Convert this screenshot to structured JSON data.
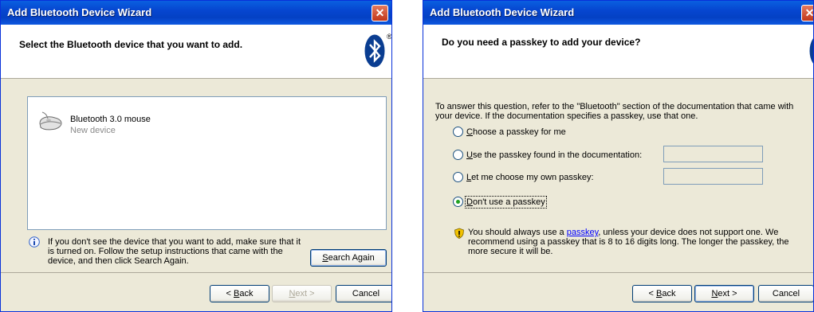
{
  "wizard1": {
    "title": "Add Bluetooth Device Wizard",
    "close_glyph": "✕",
    "heading": "Select the Bluetooth device that you want to add.",
    "registered_mark": "®",
    "device": {
      "name": "Bluetooth 3.0 mouse",
      "status": "New device",
      "icon": "mouse-icon"
    },
    "info_icon": "info-icon",
    "info_text": "If you don't see the device that you want to add, make sure that it is turned on. Follow the setup instructions that came with the device, and then click Search Again.",
    "search_again": {
      "prefix": "",
      "accel": "S",
      "rest": "earch Again"
    },
    "back": {
      "prefix": "< ",
      "accel": "B",
      "rest": "ack"
    },
    "next": {
      "prefix": "",
      "accel": "N",
      "rest": "ext >"
    },
    "cancel": "Cancel"
  },
  "wizard2": {
    "title": "Add Bluetooth Device Wizard",
    "close_glyph": "✕",
    "heading": "Do you need a passkey to add your device?",
    "registered_mark": "®",
    "question": "To answer this question, refer to the \"Bluetooth\" section of the documentation that came with your device. If the documentation specifies a passkey, use that one.",
    "options": [
      {
        "accel": "C",
        "rest": "hoose a passkey for me",
        "checked": false
      },
      {
        "accel": "U",
        "rest": "se the passkey found in the documentation:",
        "checked": false
      },
      {
        "accel": "L",
        "rest": "et me choose my own passkey:",
        "checked": false
      },
      {
        "accel": "D",
        "rest": "on't use a passkey",
        "checked": true
      }
    ],
    "passkey_doc_value": "",
    "passkey_own_value": "",
    "warning_icon": "shield-warning-icon",
    "warning_before": "You should always use a ",
    "warning_link": "passkey",
    "warning_after": ", unless your device does not support one. We recommend using a passkey that is 8 to 16 digits long. The longer the passkey, the more secure it will be.",
    "back": {
      "prefix": "< ",
      "accel": "B",
      "rest": "ack"
    },
    "next": {
      "prefix": "",
      "accel": "N",
      "rest": "ext >"
    },
    "cancel": "Cancel"
  },
  "colors": {
    "titlebar": "#0646d0",
    "dialog_bg": "#ece9d8",
    "bluetooth": "#0a3d91",
    "link": "#0000ff"
  }
}
